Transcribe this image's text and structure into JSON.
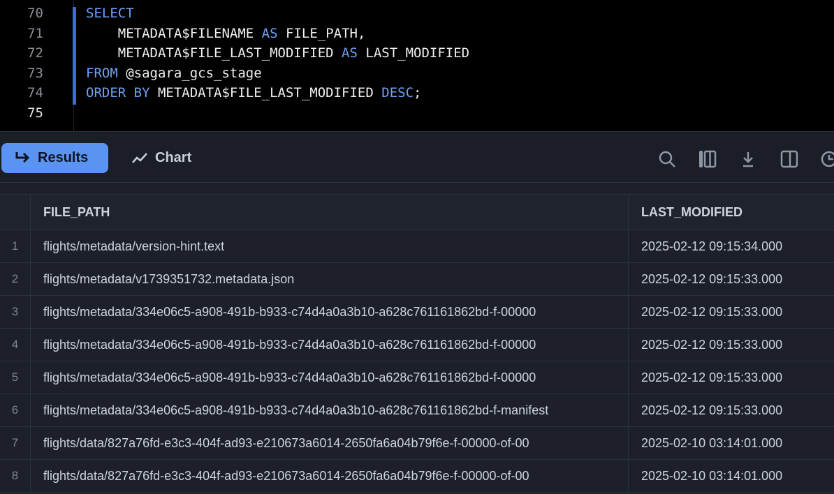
{
  "editor": {
    "lines": [
      {
        "n": "70",
        "parts": [
          {
            "t": "SELECT",
            "kw": true
          }
        ]
      },
      {
        "n": "71",
        "parts": [
          {
            "t": "    METADATA$FILENAME ",
            "kw": false
          },
          {
            "t": "AS",
            "kw": true
          },
          {
            "t": " FILE_PATH,",
            "kw": false
          }
        ]
      },
      {
        "n": "72",
        "parts": [
          {
            "t": "    METADATA$FILE_LAST_MODIFIED ",
            "kw": false
          },
          {
            "t": "AS",
            "kw": true
          },
          {
            "t": " LAST_MODIFIED",
            "kw": false
          }
        ]
      },
      {
        "n": "73",
        "parts": [
          {
            "t": "FROM",
            "kw": true
          },
          {
            "t": " @sagara_gcs_stage",
            "kw": false
          }
        ]
      },
      {
        "n": "74",
        "parts": [
          {
            "t": "ORDER BY",
            "kw": true
          },
          {
            "t": " METADATA$FILE_LAST_MODIFIED ",
            "kw": false
          },
          {
            "t": "DESC",
            "kw": true
          },
          {
            "t": ";",
            "kw": false
          }
        ]
      },
      {
        "n": "75",
        "parts": []
      }
    ]
  },
  "toolbar": {
    "results_label": "Results",
    "chart_label": "Chart",
    "icons": [
      "search-icon",
      "columns-icon",
      "download-icon",
      "side-panel-icon",
      "history-icon"
    ],
    "accent": "#5b93f2"
  },
  "table": {
    "columns": [
      "FILE_PATH",
      "LAST_MODIFIED"
    ],
    "rows": [
      {
        "n": "1",
        "path": "flights/metadata/version-hint.text",
        "mod": "2025-02-12 09:15:34.000"
      },
      {
        "n": "2",
        "path": "flights/metadata/v1739351732.metadata.json",
        "mod": "2025-02-12 09:15:33.000"
      },
      {
        "n": "3",
        "path": "flights/metadata/334e06c5-a908-491b-b933-c74d4a0a3b10-a628c761161862bd-f-00000",
        "mod": "2025-02-12 09:15:33.000"
      },
      {
        "n": "4",
        "path": "flights/metadata/334e06c5-a908-491b-b933-c74d4a0a3b10-a628c761161862bd-f-00000",
        "mod": "2025-02-12 09:15:33.000"
      },
      {
        "n": "5",
        "path": "flights/metadata/334e06c5-a908-491b-b933-c74d4a0a3b10-a628c761161862bd-f-00000",
        "mod": "2025-02-12 09:15:33.000"
      },
      {
        "n": "6",
        "path": "flights/metadata/334e06c5-a908-491b-b933-c74d4a0a3b10-a628c761161862bd-f-manifest",
        "mod": "2025-02-12 09:15:33.000"
      },
      {
        "n": "7",
        "path": "flights/data/827a76fd-e3c3-404f-ad93-e210673a6014-2650fa6a04b79f6e-f-00000-of-00",
        "mod": "2025-02-10 03:14:01.000"
      },
      {
        "n": "8",
        "path": "flights/data/827a76fd-e3c3-404f-ad93-e210673a6014-2650fa6a04b79f6e-f-00000-of-00",
        "mod": "2025-02-10 03:14:01.000"
      }
    ]
  }
}
